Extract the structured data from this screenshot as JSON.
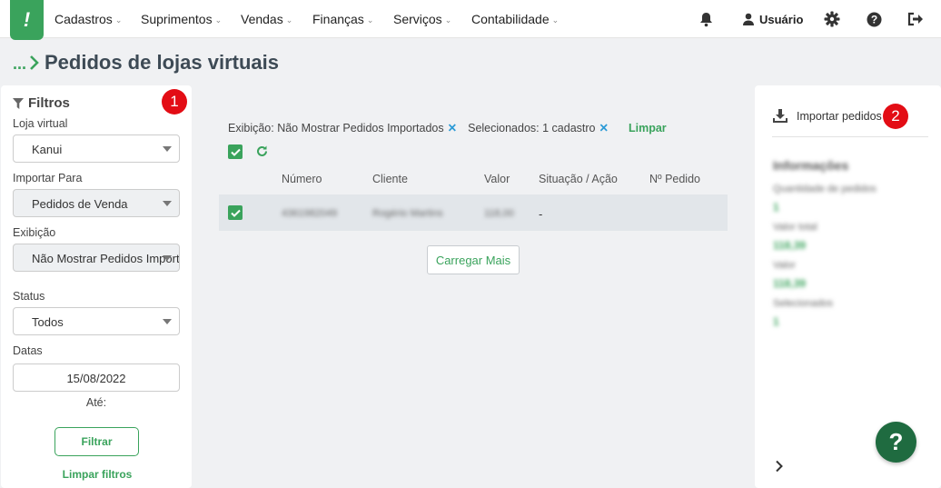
{
  "app": {
    "logo_text": "!"
  },
  "nav": {
    "items": [
      {
        "label": "Cadastros"
      },
      {
        "label": "Suprimentos"
      },
      {
        "label": "Vendas"
      },
      {
        "label": "Finanças"
      },
      {
        "label": "Serviços"
      },
      {
        "label": "Contabilidade"
      }
    ],
    "user_label": "Usuário"
  },
  "breadcrumb": {
    "ellipsis": "...",
    "title": "Pedidos de lojas virtuais"
  },
  "filters": {
    "title": "Filtros",
    "loja_label": "Loja virtual",
    "loja_value": "Kanui",
    "importar_label": "Importar Para",
    "importar_value": "Pedidos de Venda",
    "exibicao_label": "Exibição",
    "exibicao_value": "Não Mostrar Pedidos Importados",
    "status_label": "Status",
    "status_value": "Todos",
    "datas_label": "Datas",
    "date_from": "15/08/2022",
    "ate_label": "Até:",
    "filtrar_button": "Filtrar",
    "limpar_filtros": "Limpar filtros"
  },
  "badges": {
    "one": "1",
    "two": "2"
  },
  "active_filters": {
    "exibicao": "Exibição: Não Mostrar Pedidos Importados",
    "selecionados": "Selecionados: 1 cadastro",
    "remove_glyph": "✕",
    "limpar": "Limpar"
  },
  "table": {
    "columns": [
      "Número",
      "Cliente",
      "Valor",
      "Situação / Ação",
      "Nº Pedido"
    ],
    "rows": [
      {
        "numero": "4361982049",
        "cliente": "Rogério Martins",
        "valor": "118,00",
        "situacao": "-",
        "pedido": ""
      }
    ]
  },
  "load_more": "Carregar Mais",
  "right_panel": {
    "import_label": "Importar pedidos",
    "info_title": "Informações",
    "quantidade_label": "Quantidade de pedidos",
    "quantidade_value": "1",
    "valor_total_label": "Valor total",
    "valor_total_value": "118,39",
    "valor_label": "Valor",
    "valor_value": "118,39",
    "selecionados_label": "Selecionados",
    "selecionados_value": "1"
  },
  "help": {
    "glyph": "?"
  },
  "colors": {
    "accent": "#3aa35c",
    "badge": "#e30d15",
    "close": "#2b9ad6",
    "fab": "#1f6b40"
  }
}
